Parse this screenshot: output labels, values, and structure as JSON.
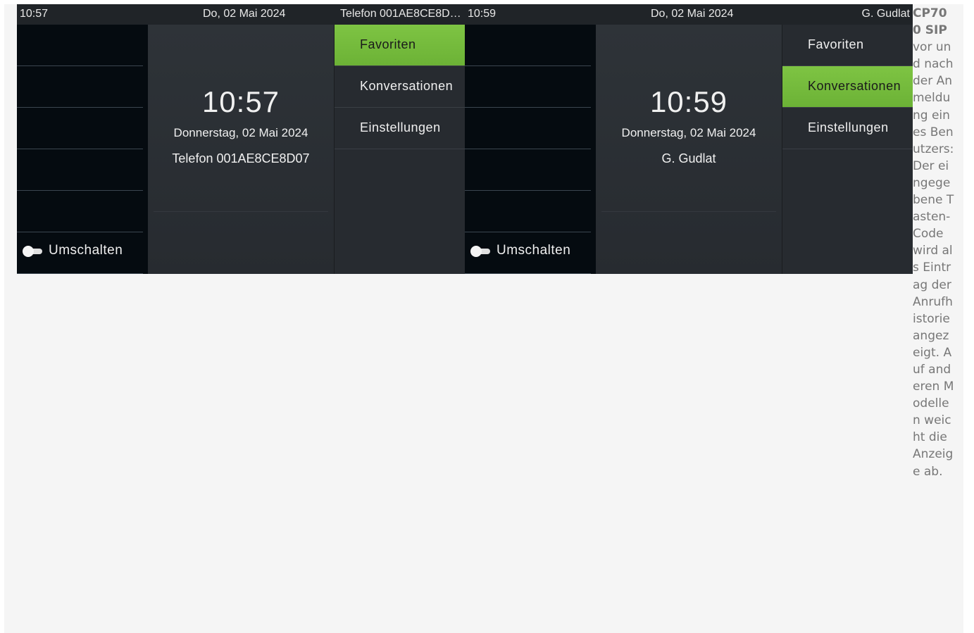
{
  "screens": [
    {
      "status": {
        "time": "10:57",
        "date": "Do, 02 Mai 2024",
        "right": "Telefon 001AE8CE8D…"
      },
      "toggle_label": "Umschalten",
      "clock": "10:57",
      "date_long": "Donnerstag, 02 Mai 2024",
      "name": "Telefon 001AE8CE8D07",
      "menu": [
        {
          "label": "Favoriten",
          "active": true
        },
        {
          "label": "Konversationen",
          "active": false
        },
        {
          "label": "Einstellungen",
          "active": false
        }
      ]
    },
    {
      "status": {
        "time": "10:59",
        "date": "Do, 02 Mai 2024",
        "right": "G. Gudlat"
      },
      "toggle_label": "Umschalten",
      "clock": "10:59",
      "date_long": "Donnerstag, 02 Mai 2024",
      "name": "G. Gudlat",
      "menu": [
        {
          "label": "Favoriten",
          "active": false
        },
        {
          "label": "Konversationen",
          "active": true
        },
        {
          "label": "Einstellungen",
          "active": false
        }
      ]
    }
  ],
  "caption": {
    "title": "CP700 SIP",
    "text": "vor und nach der Anmeldung eines Benutzers: Der eingegebene Tasten-Code wird als Eintrag der Anrufhistorie angezeigt. Auf anderen Modellen weicht die Anzeige ab."
  },
  "colors": {
    "accent": "#7ec443",
    "screen_bg": "#272b30",
    "keys_bg": "#050b10"
  }
}
